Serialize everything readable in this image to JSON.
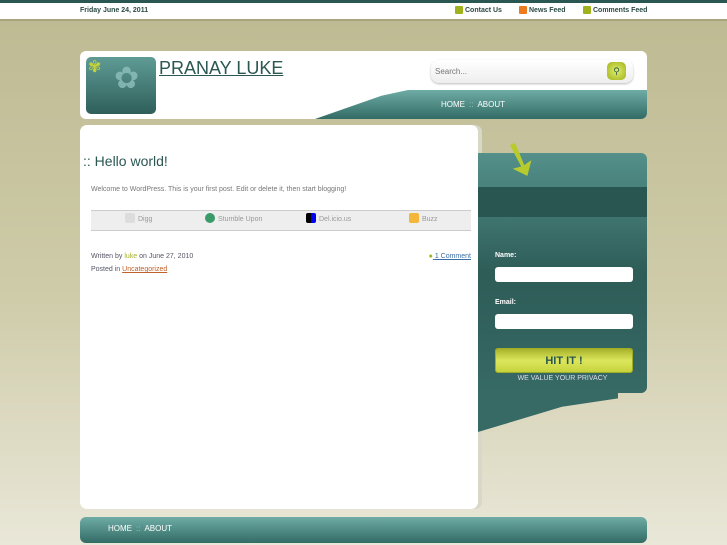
{
  "topbar": {
    "date": "Friday June 24, 2011",
    "links": [
      {
        "label": "Contact Us",
        "icon": "contact-icon",
        "color": "#9fb21c"
      },
      {
        "label": "News Feed",
        "icon": "rss-icon",
        "color": "#f07a1e"
      },
      {
        "label": "Comments Feed",
        "icon": "comments-icon",
        "color": "#9fb21c"
      }
    ]
  },
  "header": {
    "site_title": "PRANAY LUKE",
    "search_placeholder": "Search...",
    "nav": [
      "HOME",
      "ABOUT"
    ],
    "separator": "::"
  },
  "post": {
    "title": ":: Hello world!",
    "body": "Welcome to WordPress. This is your first post. Edit or delete it, then start blogging!",
    "share": [
      "Digg",
      "Stumble Upon",
      "Del.icio.us",
      "Buzz"
    ],
    "written_by": "Written by",
    "author": "luke",
    "on_date": "on June 27, 2010",
    "posted_in": "Posted in",
    "category": "Uncategorized",
    "comments": "1 Comment"
  },
  "sidebar": {
    "name_label": "Name:",
    "email_label": "Email:",
    "submit": "HIT IT !",
    "privacy": "WE VALUE YOUR PRIVACY"
  },
  "footer": {
    "nav": [
      "HOME",
      "ABOUT"
    ],
    "separator": "::"
  },
  "colors": {
    "accent": "#2b5752",
    "lime": "#c4d23c"
  }
}
